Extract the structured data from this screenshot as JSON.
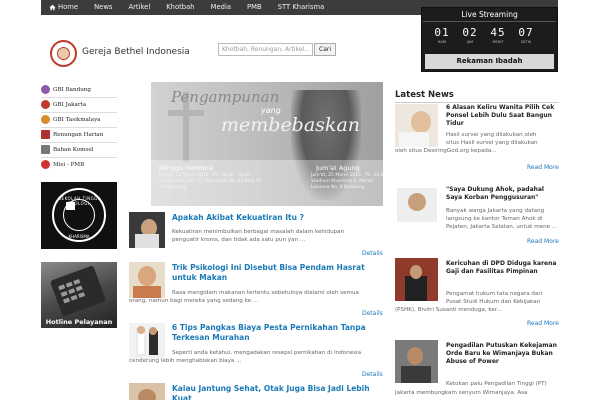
{
  "nav": {
    "items": [
      "Home",
      "News",
      "Artikel",
      "Khotbah",
      "Media",
      "PMB",
      "STT Kharisma"
    ]
  },
  "header": {
    "site_name": "Gereja Bethel Indonesia",
    "search_placeholder": "Khotbah, Renungan, Artikel...",
    "search_button": "Cari"
  },
  "live": {
    "title": "Live Streaming",
    "countdown": [
      {
        "value": "01",
        "label": "HARI"
      },
      {
        "value": "02",
        "label": "JAM"
      },
      {
        "value": "45",
        "label": "MENIT"
      },
      {
        "value": "07",
        "label": "DETIK"
      }
    ],
    "button": "Rekaman Ibadah"
  },
  "sidebar": {
    "items": [
      {
        "label": "GBI Bandung",
        "color": "#8e5ba8"
      },
      {
        "label": "GBI Jakarta",
        "color": "#c0392b"
      },
      {
        "label": "GBI Tasikmalaya",
        "color": "#d98a2b"
      },
      {
        "label": "Renungan Harian",
        "color": "#b03030"
      },
      {
        "label": "Bahan Komsel",
        "color": "#777777"
      },
      {
        "label": "Misi - PMB",
        "color": "#cc3333"
      }
    ],
    "stt_top": "SEKOLAH TINGGI TEOLOGI",
    "stt_bottom": "KHARISMA",
    "hotline": "Hotline Pelayanan"
  },
  "banner": {
    "script_title": "Pengampunan",
    "yang": "yang",
    "big_title": "membebaskan",
    "left_title": "Minggu Gembira",
    "left_sub": "Kamis, 24 Maret 2016 · Pk. 18.00 · Hyatt Convention Hall · Jl. Pasir Kaliki No 25 Blok 31 - 34 Bandung",
    "right_title": "Jum'at Agung",
    "right_sub": "Jum'at, 25 Maret 2016 · Pk. 10.00 · Stadium Kharisma Jl. Merak Lekasna No. 8 Bandung"
  },
  "articles": [
    {
      "title": "Apakah Akibat Kekuatiran Itu ?",
      "body": [
        "Kekuatiran menimbulkan berbagai masalah dalam kehidupan",
        "penguatir kronis, dan tidak ada satu pun yan ..."
      ],
      "details": "Details"
    },
    {
      "title": "Trik Psikologi Ini Disebut Bisa Pendam Hasrat untuk Makan",
      "body": [
        "Rasa mengidam makanan tertentu sebetulnya dialami oleh semua",
        "orang, namun bagi mereka yang sedang ke ..."
      ],
      "details": "Details"
    },
    {
      "title": "6 Tips Pangkas Biaya Pesta Pernikahan Tanpa Terkesan Murahan",
      "body": [
        "Seperti anda ketahui, mengadakan resepsi pernikahan di Indonesia",
        "cenderung lebih menghabiskan biaya ..."
      ],
      "details": "Details"
    },
    {
      "title": "Kalau Jantung Sehat, Otak Juga Bisa Jadi Lebih Kuat",
      "body": [],
      "details": ""
    }
  ],
  "latest": {
    "heading": "Latest News",
    "items": [
      {
        "title": "6 Alasan Keliru Wanita Pilih Cek Ponsel Lebih Dulu Saat Bangun Tidur",
        "body": [
          "Hasil survei yang dilakukan oleh",
          "situs Hasil survei yang dilakukan",
          "oleh situs DesiringGod.org kepada..."
        ],
        "more": "Read More"
      },
      {
        "title": "\"Saya Dukung Ahok, padahal Saya Korban Penggusuran\"",
        "body": [
          "Banyak warga Jakarta yang datang",
          "langsung ke kantor Teman Ahok di",
          "Pejaten, Jakarta Selatan, untuk mene ..."
        ],
        "more": "Read More"
      },
      {
        "title": "Kericuhan di DPD Diduga karena Gaji dan Fasilitas Pimpinan",
        "body": [
          "Pengamat hukum tata negara dari",
          "Pusat Studi Hukum dan Kebijakan",
          "(PSHK), Bivitri Susanti menduga, ker..."
        ],
        "more": "Read More"
      },
      {
        "title": "Pengadilan Putuskan Kekejaman Orde Baru ke Wimanjaya Bukan Abuse of Power",
        "body": [
          "Ketokan palu Pengadilan Tinggi (PT)",
          "Jakarta membungkam senyum Wimanjaya. Asa"
        ],
        "more": ""
      }
    ]
  }
}
